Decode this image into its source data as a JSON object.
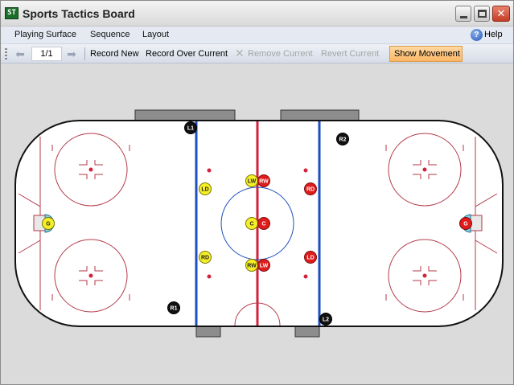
{
  "window": {
    "title": "Sports Tactics Board"
  },
  "icons": {
    "app": "app-icon",
    "minimize": "minimize-icon",
    "maximize": "maximize-icon",
    "close": "close-icon",
    "help": "help-icon",
    "back": "arrow-left-icon",
    "forward": "arrow-right-icon",
    "remove": "x-icon"
  },
  "menu": {
    "items": [
      "Playing Surface",
      "Sequence",
      "Layout"
    ],
    "help_label": "Help"
  },
  "toolbar": {
    "page": "1/1",
    "record_new": "Record New",
    "record_over": "Record Over Current",
    "remove_current": "Remove Current",
    "revert_current": "Revert Current",
    "show_movement": "Show Movement"
  },
  "colors": {
    "yellow_team": "#f4ef26",
    "red_team": "#e01b1b",
    "neutral": "#111111",
    "blue_line": "#1d4fbf",
    "red_line": "#d2223c",
    "rink_line": "#b23a4a",
    "goalie_cyan": "#7fd6e8"
  },
  "players": [
    {
      "label": "L1",
      "team": "neutral"
    },
    {
      "label": "R2",
      "team": "neutral"
    },
    {
      "label": "R1",
      "team": "neutral"
    },
    {
      "label": "L2",
      "team": "neutral"
    },
    {
      "label": "LW",
      "team": "yellow"
    },
    {
      "label": "LD",
      "team": "yellow"
    },
    {
      "label": "C",
      "team": "yellow"
    },
    {
      "label": "RD",
      "team": "yellow"
    },
    {
      "label": "RW",
      "team": "yellow"
    },
    {
      "label": "G",
      "team": "yellow"
    },
    {
      "label": "RW",
      "team": "red"
    },
    {
      "label": "RD",
      "team": "red"
    },
    {
      "label": "C",
      "team": "red"
    },
    {
      "label": "LD",
      "team": "red"
    },
    {
      "label": "LW",
      "team": "red"
    },
    {
      "label": "G",
      "team": "red"
    }
  ]
}
